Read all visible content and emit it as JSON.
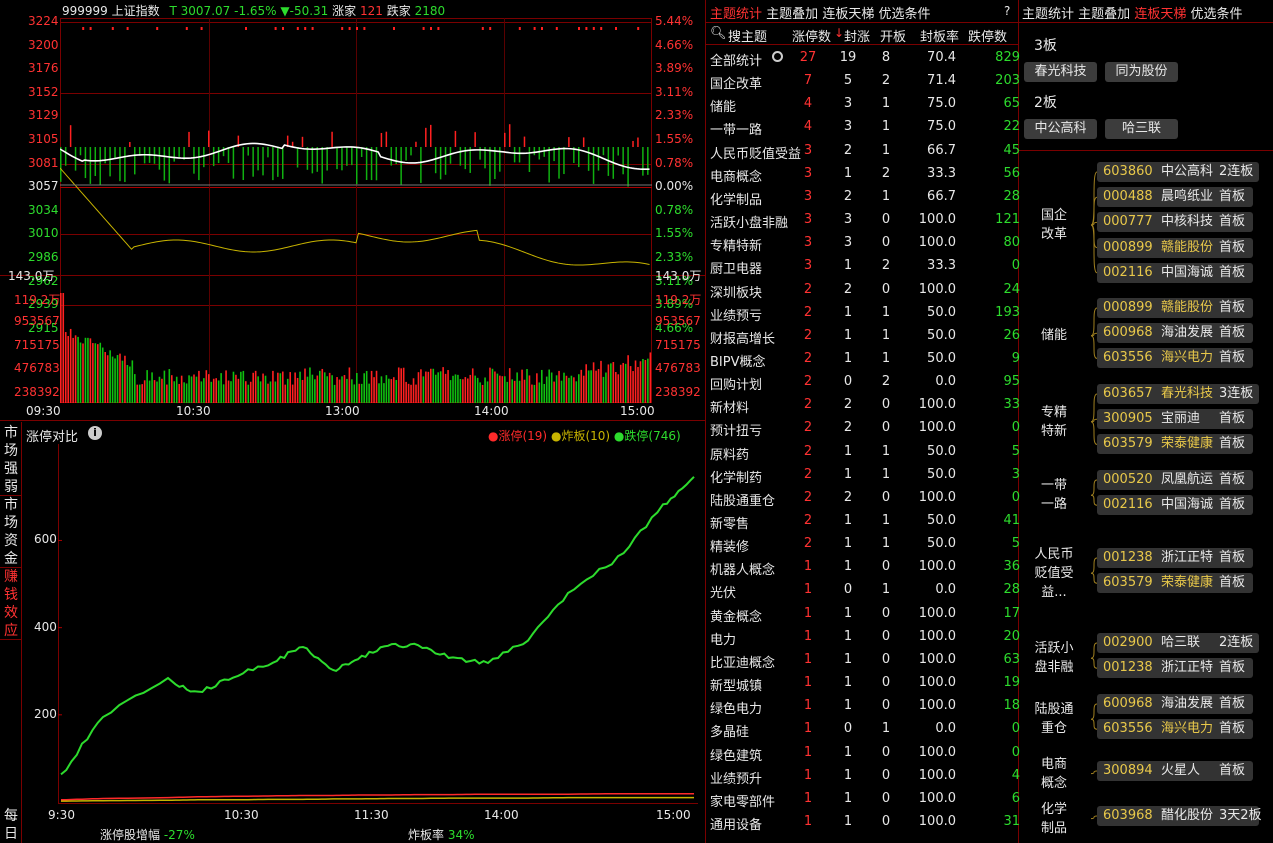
{
  "header": {
    "code": "999999",
    "name": "上证指数",
    "t": "T",
    "price": "3007.07",
    "pct": "-1.65%",
    "chg": "▼-50.31",
    "up_label": "涨家",
    "up": "121",
    "down_label": "跌家",
    "down": "2180"
  },
  "price_axis": {
    "left": [
      "3224",
      "3200",
      "3176",
      "3152",
      "3129",
      "3105",
      "3081",
      "3057",
      "3034",
      "3010",
      "2986",
      "2962",
      "2939",
      "2915"
    ],
    "right": [
      "5.44%",
      "4.66%",
      "3.89%",
      "3.11%",
      "2.33%",
      "1.55%",
      "0.78%",
      "0.00%",
      "0.78%",
      "1.55%",
      "2.33%",
      "3.11%",
      "3.89%",
      "4.66%"
    ],
    "base": "3057"
  },
  "vol_axis": {
    "left": [
      "143.0万",
      "119.2万",
      "953567",
      "715175",
      "476783",
      "238392"
    ],
    "right": [
      "143.0万",
      "119.2万",
      "953567",
      "715175",
      "476783",
      "238392"
    ]
  },
  "time_axis": [
    "09:30",
    "10:30",
    "13:00",
    "14:00",
    "15:00"
  ],
  "compare": {
    "title": "涨停对比",
    "legend": [
      {
        "label": "涨停(19)",
        "color": "#ff2a2a"
      },
      {
        "label": "炸板(10)",
        "color": "#c8b400"
      },
      {
        "label": "跌停(746)",
        "color": "#2ddc2d"
      }
    ],
    "y_ticks": [
      "600",
      "400",
      "200"
    ],
    "x_ticks": [
      "9:30",
      "10:30",
      "11:30",
      "14:00",
      "15:00"
    ],
    "footer_a_label": "涨停股增幅",
    "footer_a": "-27%",
    "footer_b_label": "炸板率",
    "footer_b": "34%"
  },
  "chart_data": {
    "type": "line",
    "x": [
      "9:30",
      "9:45",
      "10:00",
      "10:15",
      "10:30",
      "10:45",
      "11:00",
      "11:15",
      "11:30",
      "13:00",
      "13:15",
      "13:30",
      "13:45",
      "14:00",
      "14:15",
      "14:30",
      "14:45",
      "15:00"
    ],
    "series": [
      {
        "name": "跌停(746)",
        "values": [
          60,
          200,
          280,
          250,
          290,
          320,
          360,
          300,
          330,
          360,
          360,
          330,
          320,
          370,
          480,
          560,
          680,
          746
        ]
      },
      {
        "name": "涨停(19)",
        "values": [
          5,
          8,
          10,
          12,
          13,
          14,
          15,
          15,
          16,
          16,
          17,
          17,
          18,
          18,
          18,
          19,
          19,
          19
        ]
      },
      {
        "name": "炸板(10)",
        "values": [
          2,
          3,
          4,
          5,
          5,
          6,
          6,
          7,
          7,
          8,
          8,
          9,
          9,
          9,
          10,
          10,
          10,
          10
        ]
      }
    ],
    "ylim": [
      0,
      780
    ]
  },
  "side_tabs": [
    "市场强弱",
    "市场资金",
    "赚钱效应",
    "每日"
  ],
  "mid_tabs": [
    "主题统计",
    "主题叠加",
    "连板天梯",
    "优选条件",
    "?"
  ],
  "right_tabs": [
    "主题统计",
    "主题叠加",
    "连板天梯",
    "优选条件"
  ],
  "table": {
    "headers": [
      "搜主题",
      "涨停数",
      "封涨",
      "开板",
      "封板率",
      "跌停数"
    ],
    "rows": [
      [
        "全部统计",
        "27",
        "19",
        "8",
        "70.4",
        "829"
      ],
      [
        "国企改革",
        "7",
        "5",
        "2",
        "71.4",
        "203"
      ],
      [
        "储能",
        "4",
        "3",
        "1",
        "75.0",
        "65"
      ],
      [
        "一带一路",
        "4",
        "3",
        "1",
        "75.0",
        "22"
      ],
      [
        "人民币贬值受益",
        "3",
        "2",
        "1",
        "66.7",
        "45"
      ],
      [
        "电商概念",
        "3",
        "1",
        "2",
        "33.3",
        "56"
      ],
      [
        "化学制品",
        "3",
        "2",
        "1",
        "66.7",
        "28"
      ],
      [
        "活跃小盘非融",
        "3",
        "3",
        "0",
        "100.0",
        "121"
      ],
      [
        "专精特新",
        "3",
        "3",
        "0",
        "100.0",
        "80"
      ],
      [
        "厨卫电器",
        "3",
        "1",
        "2",
        "33.3",
        "0"
      ],
      [
        "深圳板块",
        "2",
        "2",
        "0",
        "100.0",
        "24"
      ],
      [
        "业绩预亏",
        "2",
        "1",
        "1",
        "50.0",
        "193"
      ],
      [
        "财报高增长",
        "2",
        "1",
        "1",
        "50.0",
        "26"
      ],
      [
        "BIPV概念",
        "2",
        "1",
        "1",
        "50.0",
        "9"
      ],
      [
        "回购计划",
        "2",
        "0",
        "2",
        "0.0",
        "95"
      ],
      [
        "新材料",
        "2",
        "2",
        "0",
        "100.0",
        "33"
      ],
      [
        "预计扭亏",
        "2",
        "2",
        "0",
        "100.0",
        "0"
      ],
      [
        "原料药",
        "2",
        "1",
        "1",
        "50.0",
        "5"
      ],
      [
        "化学制药",
        "2",
        "1",
        "1",
        "50.0",
        "3"
      ],
      [
        "陆股通重仓",
        "2",
        "2",
        "0",
        "100.0",
        "0"
      ],
      [
        "新零售",
        "2",
        "1",
        "1",
        "50.0",
        "41"
      ],
      [
        "精装修",
        "2",
        "1",
        "1",
        "50.0",
        "5"
      ],
      [
        "机器人概念",
        "1",
        "1",
        "0",
        "100.0",
        "36"
      ],
      [
        "光伏",
        "1",
        "0",
        "1",
        "0.0",
        "28"
      ],
      [
        "黄金概念",
        "1",
        "1",
        "0",
        "100.0",
        "17"
      ],
      [
        "电力",
        "1",
        "1",
        "0",
        "100.0",
        "20"
      ],
      [
        "比亚迪概念",
        "1",
        "1",
        "0",
        "100.0",
        "63"
      ],
      [
        "新型城镇",
        "1",
        "1",
        "0",
        "100.0",
        "19"
      ],
      [
        "绿色电力",
        "1",
        "1",
        "0",
        "100.0",
        "18"
      ],
      [
        "多晶硅",
        "1",
        "0",
        "1",
        "0.0",
        "0"
      ],
      [
        "绿色建筑",
        "1",
        "1",
        "0",
        "100.0",
        "0"
      ],
      [
        "业绩预升",
        "1",
        "1",
        "0",
        "100.0",
        "4"
      ],
      [
        "家电零部件",
        "1",
        "1",
        "0",
        "100.0",
        "6"
      ],
      [
        "通用设备",
        "1",
        "1",
        "0",
        "100.0",
        "31"
      ]
    ]
  },
  "ladder": [
    {
      "level": "3板",
      "stocks": [
        "春光科技",
        "同为股份"
      ]
    },
    {
      "level": "2板",
      "stocks": [
        "中公高科",
        "哈三联"
      ]
    }
  ],
  "groups": [
    {
      "name": [
        "国企",
        "改革"
      ],
      "items": [
        [
          "603860",
          "中公高科",
          "2连板",
          false
        ],
        [
          "000488",
          "晨鸣纸业",
          "首板",
          false
        ],
        [
          "000777",
          "中核科技",
          "首板",
          false
        ],
        [
          "000899",
          "赣能股份",
          "首板",
          true
        ],
        [
          "002116",
          "中国海诚",
          "首板",
          false
        ]
      ]
    },
    {
      "name": [
        "储能"
      ],
      "items": [
        [
          "000899",
          "赣能股份",
          "首板",
          true
        ],
        [
          "600968",
          "海油发展",
          "首板",
          false
        ],
        [
          "603556",
          "海兴电力",
          "首板",
          true
        ]
      ]
    },
    {
      "name": [
        "专精",
        "特新"
      ],
      "items": [
        [
          "603657",
          "春光科技",
          "3连板",
          true
        ],
        [
          "300905",
          "宝丽迪",
          "首板",
          false
        ],
        [
          "603579",
          "荣泰健康",
          "首板",
          true
        ]
      ]
    },
    {
      "name": [
        "一带",
        "一路"
      ],
      "items": [
        [
          "000520",
          "凤凰航运",
          "首板",
          false
        ],
        [
          "002116",
          "中国海诚",
          "首板",
          false
        ]
      ]
    },
    {
      "name": [
        "人民币",
        "贬值受",
        "益..."
      ],
      "items": [
        [
          "001238",
          "浙江正特",
          "首板",
          false
        ],
        [
          "603579",
          "荣泰健康",
          "首板",
          true
        ]
      ]
    },
    {
      "name": [
        "活跃小",
        "盘非融"
      ],
      "items": [
        [
          "002900",
          "哈三联",
          "2连板",
          false
        ],
        [
          "001238",
          "浙江正特",
          "首板",
          false
        ]
      ]
    },
    {
      "name": [
        "陆股通",
        "重仓"
      ],
      "items": [
        [
          "600968",
          "海油发展",
          "首板",
          false
        ],
        [
          "603556",
          "海兴电力",
          "首板",
          true
        ]
      ]
    },
    {
      "name": [
        "电商",
        "概念"
      ],
      "items": [
        [
          "300894",
          "火星人",
          "首板",
          false
        ]
      ]
    },
    {
      "name": [
        "化学",
        "制品"
      ],
      "items": [
        [
          "603968",
          "醋化股份",
          "3天2板",
          false
        ]
      ]
    }
  ]
}
